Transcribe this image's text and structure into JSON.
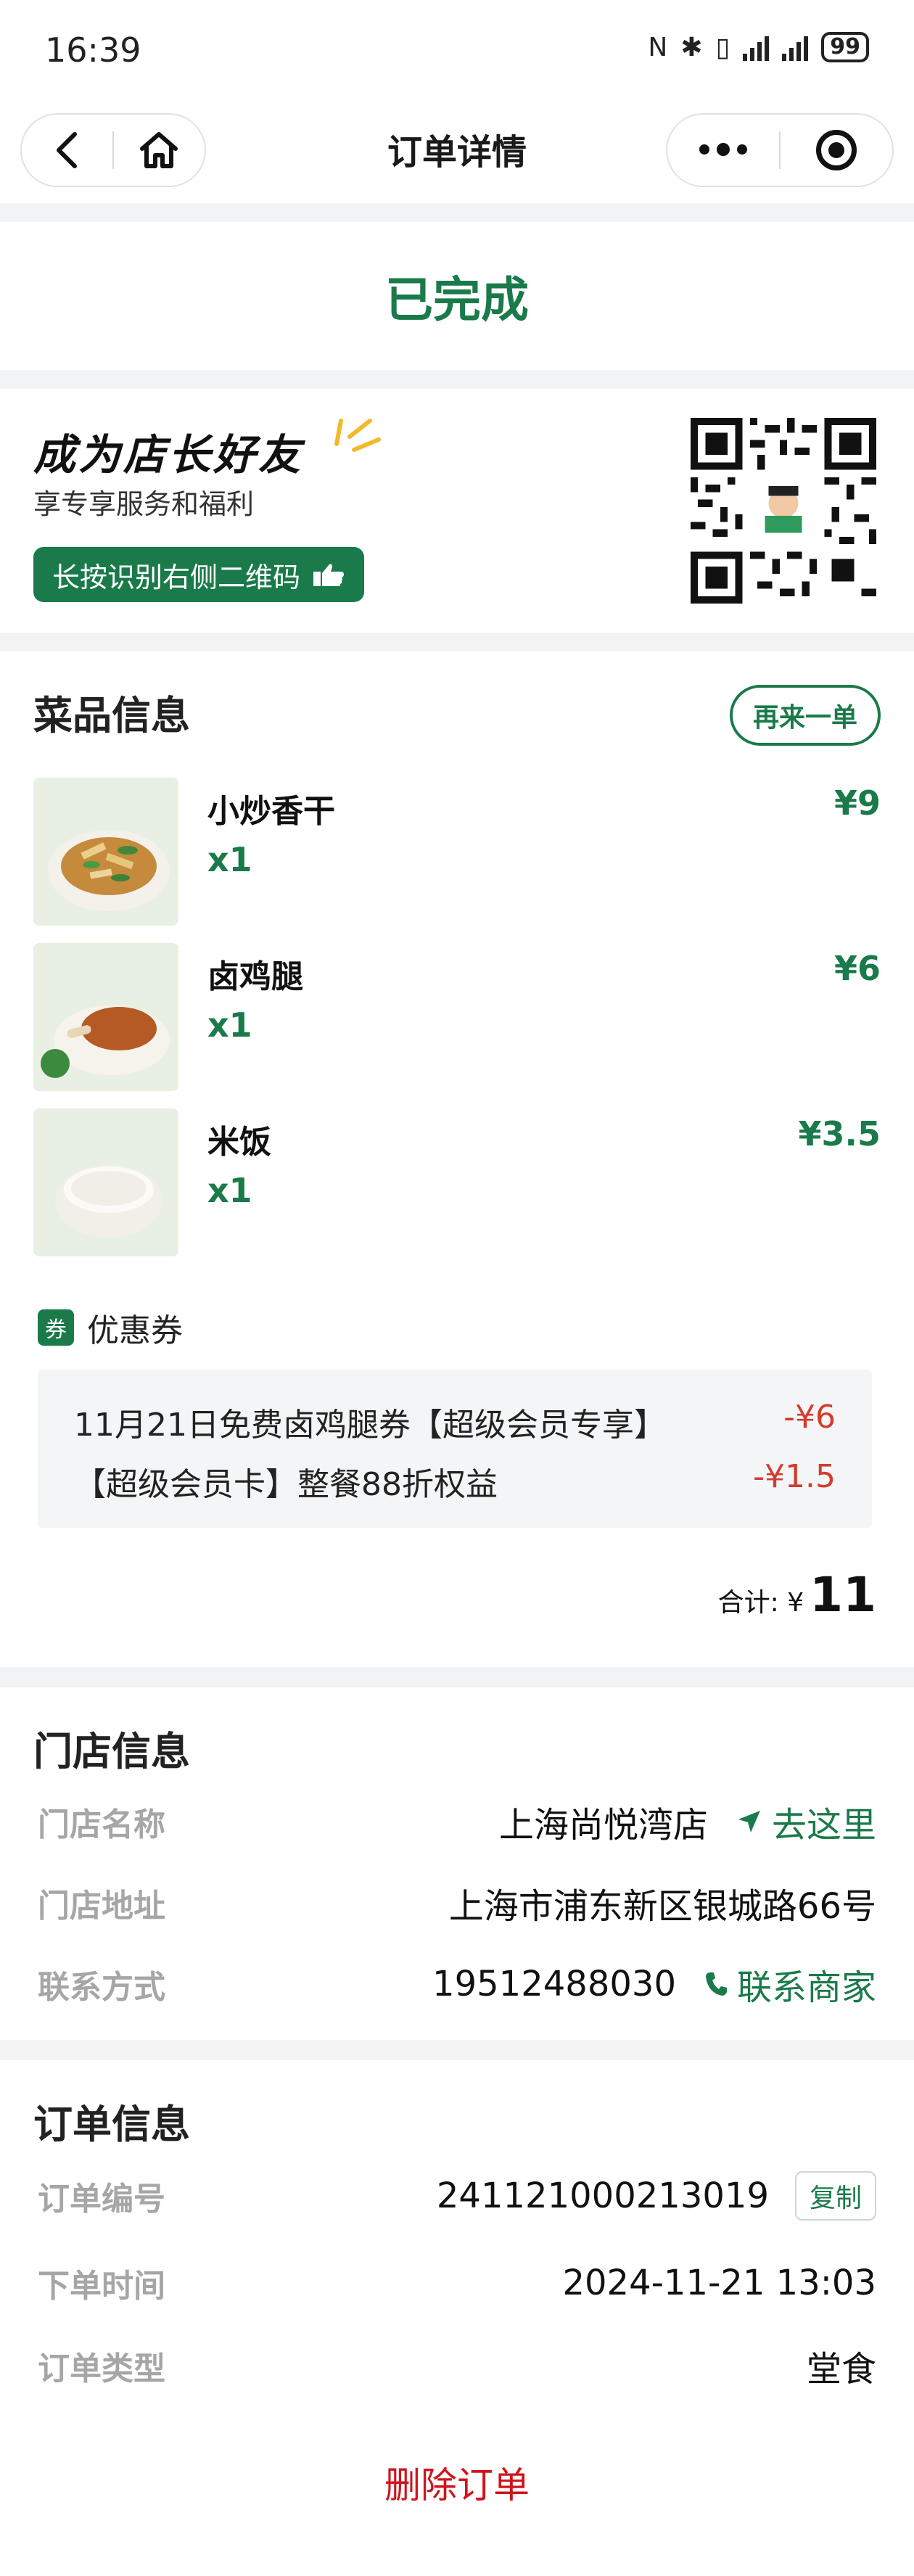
{
  "status_bar": {
    "time": "16:39",
    "battery": "99"
  },
  "nav": {
    "title": "订单详情",
    "back_icon": "chevron-left-icon",
    "home_icon": "home-icon",
    "more_icon": "more-dots-icon",
    "target_icon": "record-target-icon"
  },
  "order_status": "已完成",
  "friend_card": {
    "title": "成为店长好友",
    "subtitle": "享专享服务和福利",
    "button": "长按识别右侧二维码"
  },
  "dishes": {
    "title": "菜品信息",
    "reorder": "再来一单",
    "items": [
      {
        "name": "小炒香干",
        "qty": "x1",
        "price": "¥9"
      },
      {
        "name": "卤鸡腿",
        "qty": "x1",
        "price": "¥6"
      },
      {
        "name": "米饭",
        "qty": "x1",
        "price": "¥3.5"
      }
    ],
    "coupon_badge": "券",
    "coupon_label": "优惠券",
    "coupons": [
      {
        "name": "11月21日免费卤鸡腿券【超级会员专享】",
        "amount": "-¥6"
      },
      {
        "name": "【超级会员卡】整餐88折权益",
        "amount": "-¥1.5"
      }
    ],
    "total_label": "合计: ¥",
    "total_value": "11"
  },
  "store": {
    "title": "门店信息",
    "name_key": "门店名称",
    "name_val": "上海尚悦湾店",
    "goto": "去这里",
    "address_key": "门店地址",
    "address_val": "上海市浦东新区银城路66号",
    "contact_key": "联系方式",
    "contact_val": "19512488030",
    "contact_link": "联系商家"
  },
  "order": {
    "title": "订单信息",
    "no_key": "订单编号",
    "no_val": "241121000213019",
    "copy": "复制",
    "time_key": "下单时间",
    "time_val": "2024-11-21 13:03",
    "type_key": "订单类型",
    "type_val": "堂食",
    "delete": "删除订单"
  },
  "colors": {
    "brand_green": "#1a7a4a",
    "discount_red": "#d23c2e",
    "delete_red": "#d0141c"
  }
}
